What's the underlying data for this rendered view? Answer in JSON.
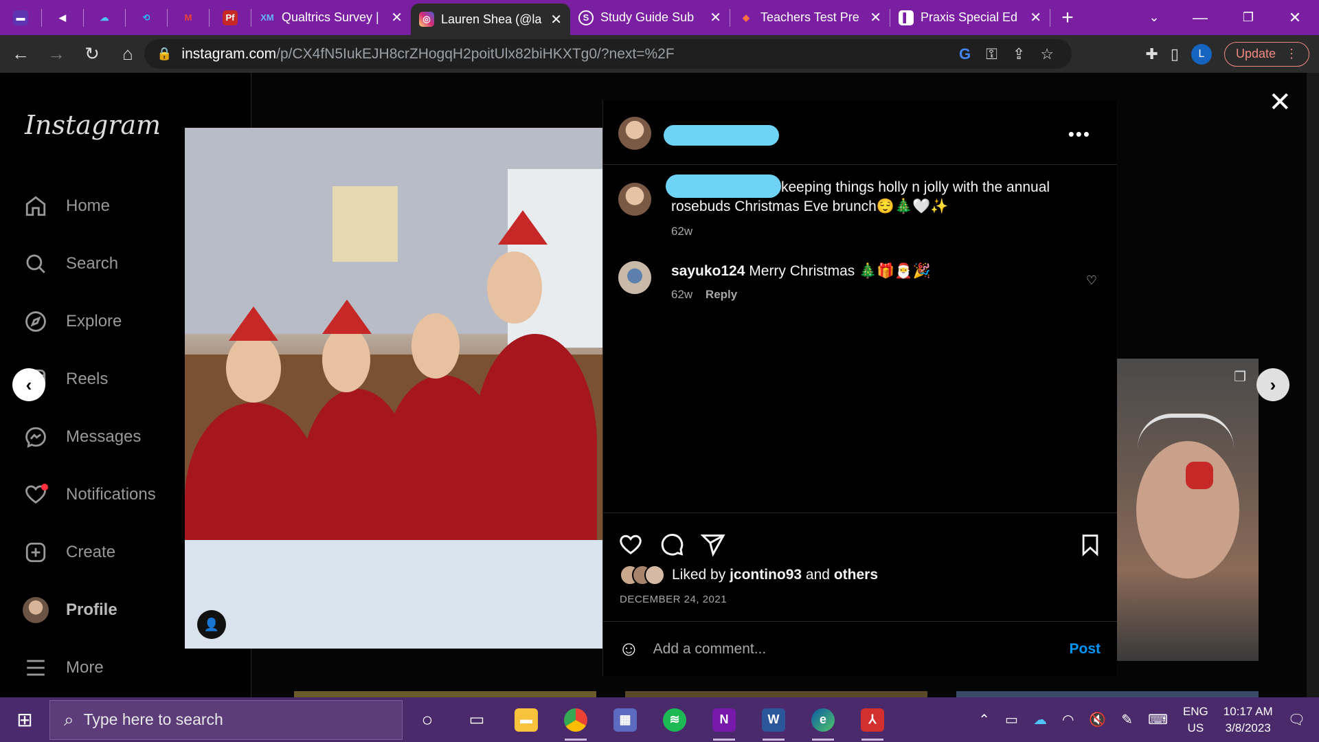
{
  "browser": {
    "tabs": [
      {
        "label": "",
        "icon": "purple-app-icon",
        "small": true
      },
      {
        "label": "",
        "icon": "speaker-icon",
        "small": true
      },
      {
        "label": "",
        "icon": "onedrive-icon",
        "small": true
      },
      {
        "label": "",
        "icon": "copilot-icon",
        "small": true
      },
      {
        "label": "",
        "icon": "gmail-icon",
        "small": true
      },
      {
        "label": "",
        "icon": "pf-icon",
        "small": true
      },
      {
        "label": "Qualtrics Survey |",
        "icon": "XM",
        "small": false
      },
      {
        "label": "Lauren Shea (@la",
        "icon": "instagram-icon",
        "small": false,
        "active": true
      },
      {
        "label": "Study Guide Sub",
        "icon": "S",
        "small": false
      },
      {
        "label": "Teachers Test Pre",
        "icon": "teachers-test-icon",
        "small": false
      },
      {
        "label": "Praxis Special Ed",
        "icon": "praxis-icon",
        "small": false
      }
    ],
    "url_host": "instagram.com",
    "url_path": "/p/CX4fN5IukEJH8crZHogqH2poitUlx82biHKXTg0/?next=%2F",
    "profile_initial": "L",
    "update_label": "Update"
  },
  "instagram": {
    "logo": "Instagram",
    "nav": [
      {
        "label": "Home",
        "icon": "home-icon"
      },
      {
        "label": "Search",
        "icon": "search-icon"
      },
      {
        "label": "Explore",
        "icon": "explore-icon"
      },
      {
        "label": "Reels",
        "icon": "reels-icon"
      },
      {
        "label": "Messages",
        "icon": "messages-icon"
      },
      {
        "label": "Notifications",
        "icon": "heart-icon"
      },
      {
        "label": "Create",
        "icon": "create-icon"
      },
      {
        "label": "Profile",
        "icon": "profile-avatar"
      },
      {
        "label": "More",
        "icon": "menu-icon"
      }
    ],
    "post": {
      "caption_text": "keeping things holly n jolly with the annual rosebuds Christmas Eve brunch😌🎄🤍✨",
      "caption_time": "62w",
      "comment_user": "sayuko124",
      "comment_text": "Merry Christmas 🎄🎁🎅🎉",
      "comment_time": "62w",
      "reply_label": "Reply",
      "liked_by_prefix": "Liked by",
      "liked_by_user": "jcontino93",
      "liked_by_and": "and",
      "liked_by_others": "others",
      "date": "DECEMBER 24, 2021",
      "comment_placeholder": "Add a comment...",
      "post_label": "Post"
    }
  },
  "taskbar": {
    "search_placeholder": "Type here to search",
    "lang_top": "ENG",
    "lang_bottom": "US",
    "time": "10:17 AM",
    "date": "3/8/2023"
  }
}
